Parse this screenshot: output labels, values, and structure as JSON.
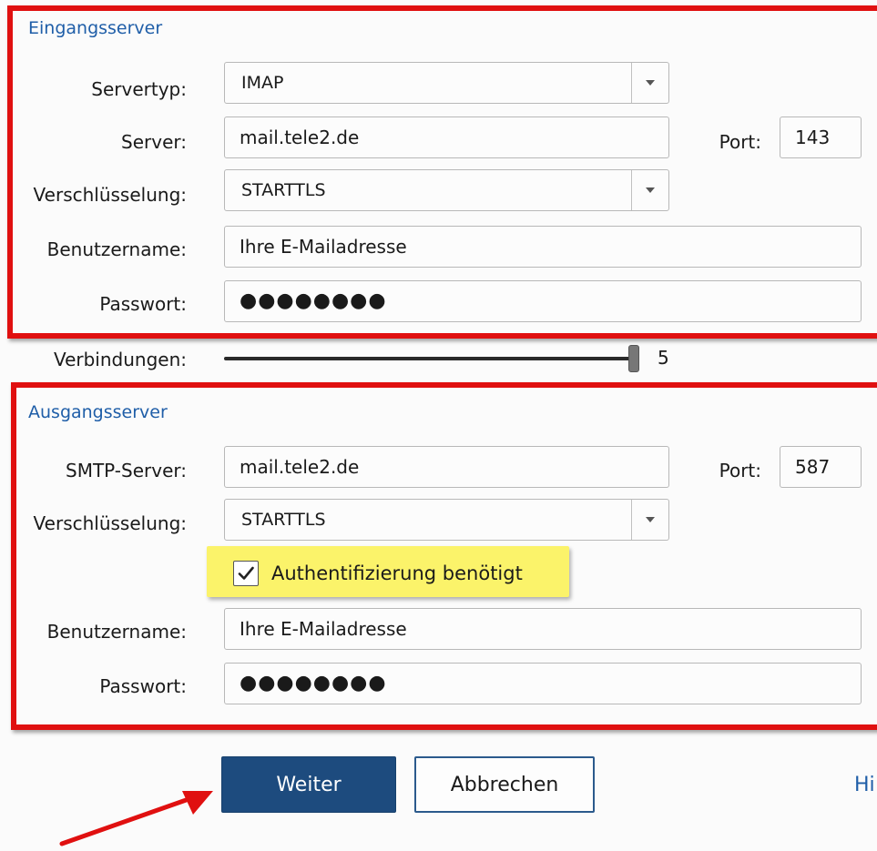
{
  "incoming": {
    "title": "Eingangsserver",
    "server_type": {
      "label": "Servertyp:",
      "value": "IMAP"
    },
    "server": {
      "label": "Server:",
      "value": "mail.tele2.de"
    },
    "port": {
      "label": "Port:",
      "value": "143"
    },
    "encryption": {
      "label": "Verschlüsselung:",
      "value": "STARTTLS"
    },
    "username": {
      "label": "Benutzername:",
      "value": "Ihre E-Mailadresse"
    },
    "password": {
      "label": "Passwort:",
      "value": "●●●●●●●●"
    }
  },
  "connections": {
    "label": "Verbindungen:",
    "value": "5",
    "level": 1.0
  },
  "outgoing": {
    "title": "Ausgangsserver",
    "smtp_server": {
      "label": "SMTP-Server:",
      "value": "mail.tele2.de"
    },
    "port": {
      "label": "Port:",
      "value": "587"
    },
    "encryption": {
      "label": "Verschlüsselung:",
      "value": "STARTTLS"
    },
    "auth_required": {
      "label": "Authentifizierung benötigt",
      "checked": true
    },
    "username": {
      "label": "Benutzername:",
      "value": "Ihre E-Mailadresse"
    },
    "password": {
      "label": "Passwort:",
      "value": "●●●●●●●●"
    }
  },
  "buttons": {
    "next": "Weiter",
    "cancel": "Abbrechen",
    "help": "Hi"
  },
  "colors": {
    "accent": "#1d4b7e",
    "annotation": "#e01010",
    "highlight": "#fbf36a",
    "section_title": "#1f5ea8"
  }
}
